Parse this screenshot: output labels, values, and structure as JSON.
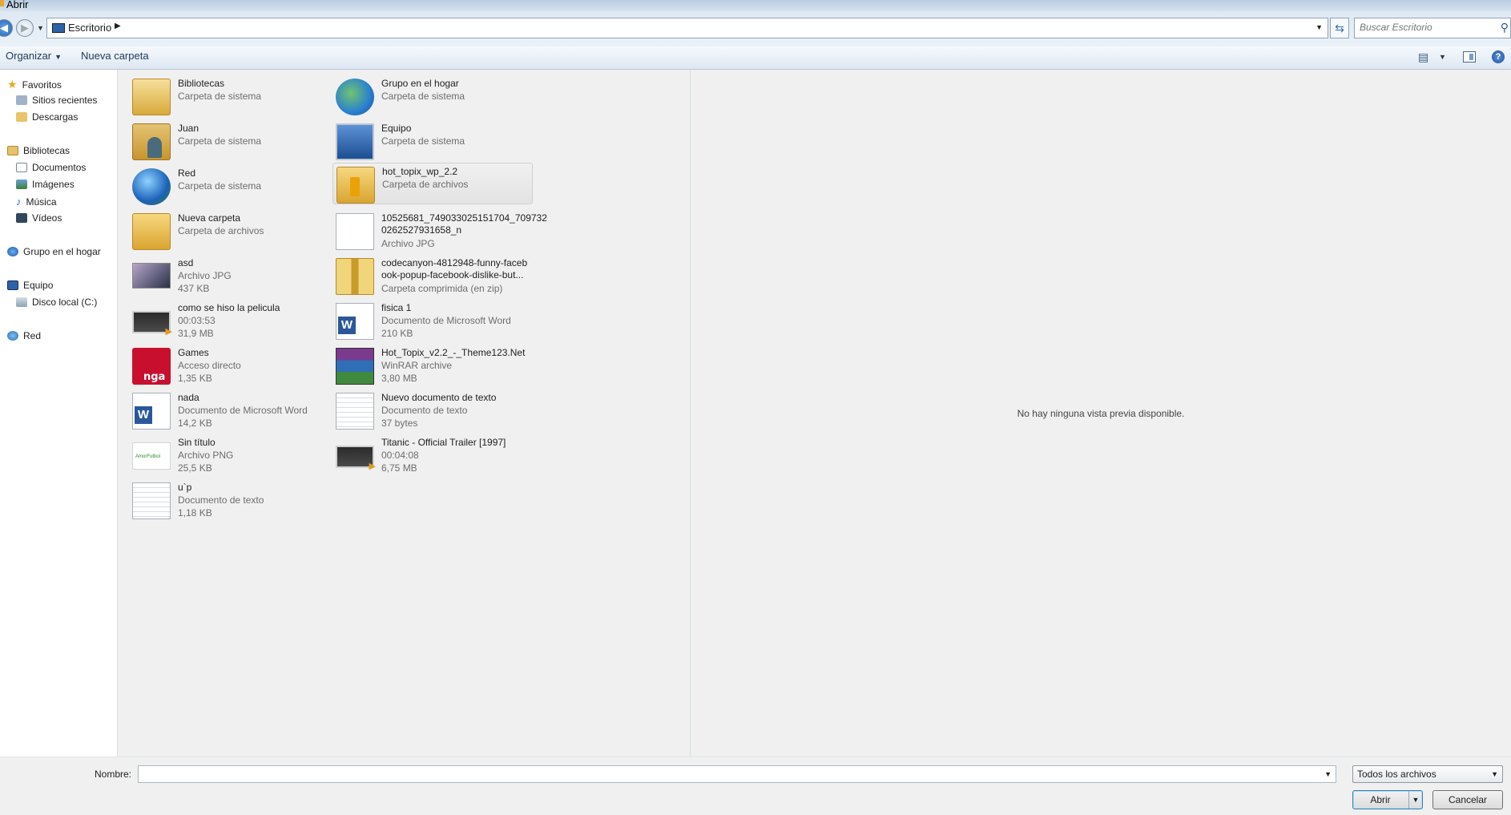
{
  "window": {
    "title": "Abrir"
  },
  "address": {
    "breadcrumb": "Escritorio"
  },
  "search": {
    "placeholder": "Buscar Escritorio"
  },
  "toolbar": {
    "organize_label": "Organizar",
    "new_folder_label": "Nueva carpeta"
  },
  "nav": {
    "favorites": "Favoritos",
    "recent": "Sitios recientes",
    "downloads": "Descargas",
    "libraries": "Bibliotecas",
    "documents": "Documentos",
    "images": "Imágenes",
    "music": "Música",
    "videos": "Vídeos",
    "homegroup": "Grupo en el hogar",
    "computer": "Equipo",
    "local_disk": "Disco local (C:)",
    "network": "Red"
  },
  "files": {
    "bibliotecas": {
      "name": "Bibliotecas",
      "type": "Carpeta de sistema"
    },
    "grupo": {
      "name": "Grupo en el hogar",
      "type": "Carpeta de sistema"
    },
    "juan": {
      "name": "Juan",
      "type": "Carpeta de sistema"
    },
    "equipo": {
      "name": "Equipo",
      "type": "Carpeta de sistema"
    },
    "red": {
      "name": "Red",
      "type": "Carpeta de sistema"
    },
    "hottopix": {
      "name": "hot_topix_wp_2.2",
      "type": "Carpeta de archivos"
    },
    "nueva": {
      "name": "Nueva carpeta",
      "type": "Carpeta de archivos"
    },
    "jpg1": {
      "name": "10525681_749033025151704_709732 0262527931658_n",
      "type": "Archivo JPG"
    },
    "asd": {
      "name": "asd",
      "type": "Archivo JPG",
      "size": "437 KB"
    },
    "codecanyon": {
      "name": "codecanyon-4812948-funny-faceb ook-popup-facebook-dislike-but...",
      "type": "Carpeta comprimida (en zip)"
    },
    "pelicula": {
      "name": "como se hiso la pelicula",
      "type": "00:03:53",
      "size": "31,9 MB"
    },
    "fisica": {
      "name": "fisica 1",
      "type": "Documento de Microsoft Word",
      "size": "210 KB"
    },
    "games": {
      "name": "Games",
      "type": "Acceso directo",
      "size": "1,35 KB"
    },
    "hotrar": {
      "name": "Hot_Topix_v2.2_-_Theme123.Net",
      "type": "WinRAR archive",
      "size": "3,80 MB"
    },
    "nada": {
      "name": "nada",
      "type": "Documento de Microsoft Word",
      "size": "14,2 KB"
    },
    "nuevodoc": {
      "name": "Nuevo documento de texto",
      "type": "Documento de texto",
      "size": "37 bytes"
    },
    "sintitulo": {
      "name": "Sin título",
      "type": "Archivo PNG",
      "size": "25,5 KB"
    },
    "titanic": {
      "name": "Titanic - Official Trailer [1997]",
      "type": "00:04:08",
      "size": "6,75 MB"
    },
    "up": {
      "name": "u`p",
      "type": "Documento de texto",
      "size": "1,18 KB"
    }
  },
  "preview": {
    "message": "No hay ninguna vista previa disponible."
  },
  "footer": {
    "name_label": "Nombre:",
    "name_value": "",
    "filter_value": "Todos los archivos",
    "open_label": "Abrir",
    "cancel_label": "Cancelar"
  }
}
